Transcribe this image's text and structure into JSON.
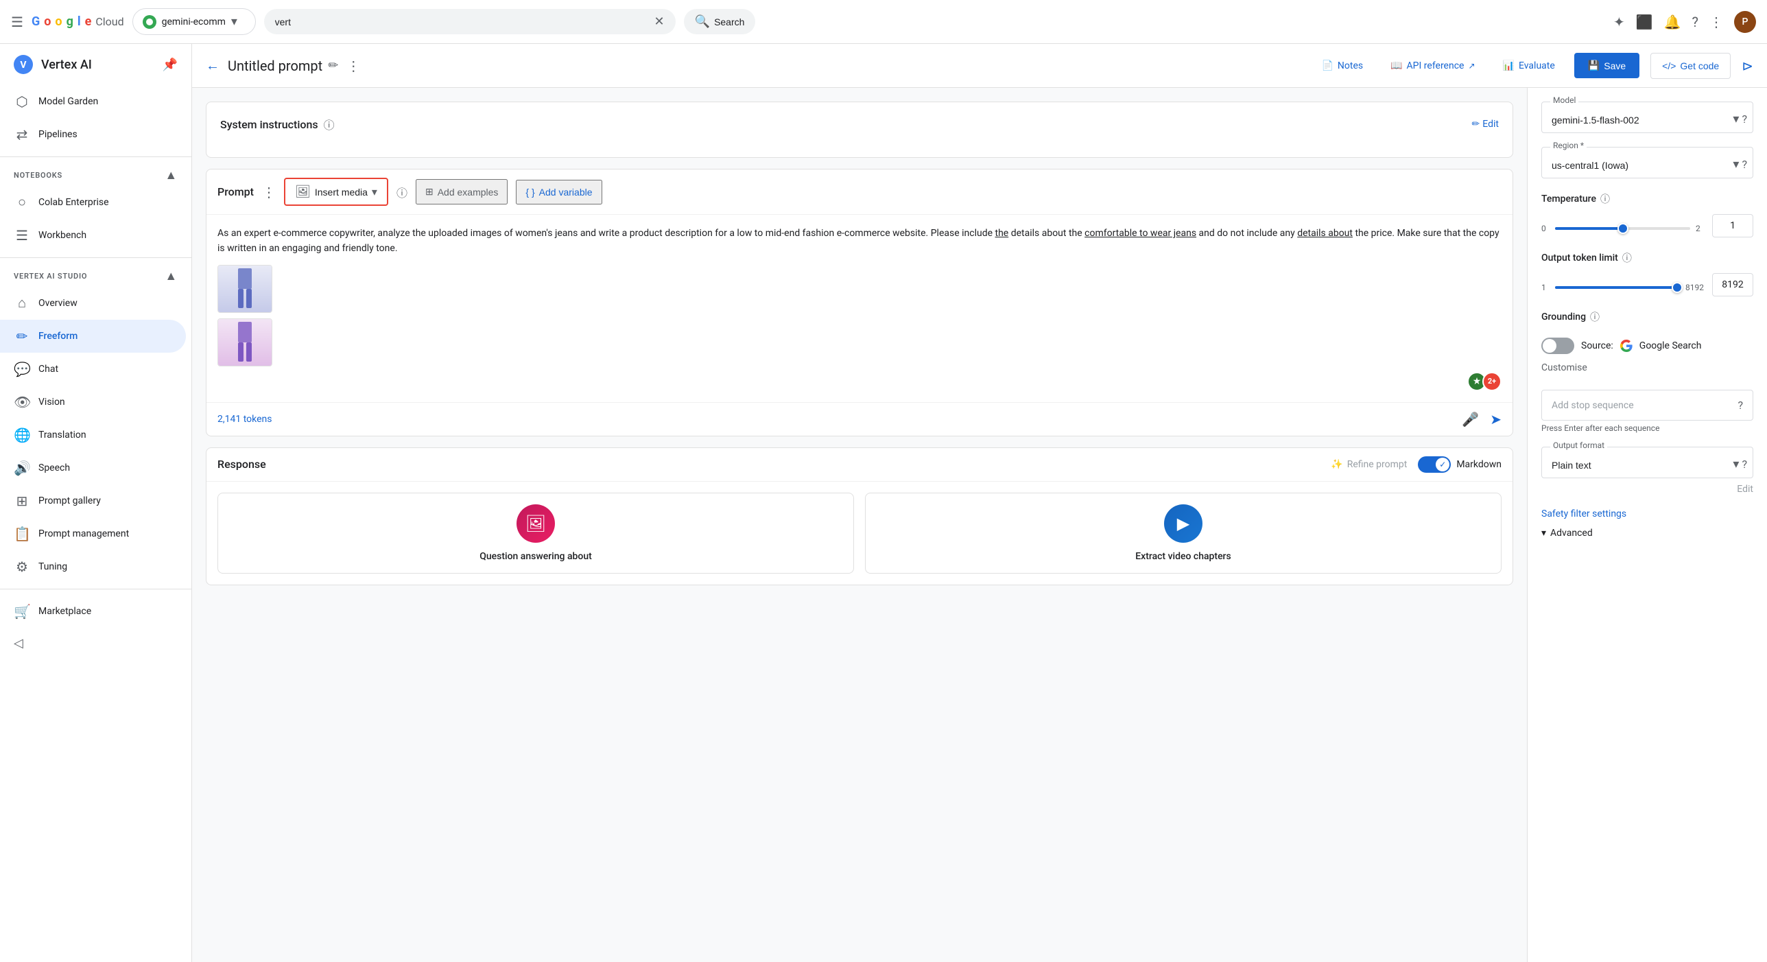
{
  "topbar": {
    "hamburger_label": "☰",
    "logo_g": "G",
    "logo_o1": "o",
    "logo_o2": "o",
    "logo_g2": "g",
    "logo_l": "l",
    "logo_e": "e",
    "logo_cloud": " Cloud",
    "project_name": "gemini-ecomm",
    "search_value": "vert",
    "search_placeholder": "Search",
    "search_button_label": "Search"
  },
  "sidebar": {
    "title": "Vertex AI",
    "items_top": [
      {
        "label": "Model Garden",
        "icon": "⬡"
      },
      {
        "label": "Pipelines",
        "icon": "⇄"
      }
    ],
    "notebooks_section": "NOTEBOOKS",
    "notebooks_items": [
      {
        "label": "Colab Enterprise",
        "icon": "○"
      },
      {
        "label": "Workbench",
        "icon": "☰"
      }
    ],
    "vertex_section": "VERTEX AI STUDIO",
    "vertex_items": [
      {
        "label": "Overview",
        "icon": "⌂"
      },
      {
        "label": "Freeform",
        "icon": "✏",
        "active": true
      },
      {
        "label": "Chat",
        "icon": "💬"
      },
      {
        "label": "Vision",
        "icon": "👁"
      },
      {
        "label": "Translation",
        "icon": "🌐"
      },
      {
        "label": "Speech",
        "icon": "🔊"
      },
      {
        "label": "Prompt gallery",
        "icon": "⊞"
      },
      {
        "label": "Prompt management",
        "icon": "📋"
      },
      {
        "label": "Tuning",
        "icon": "⚙"
      }
    ],
    "bottom_items": [
      {
        "label": "Marketplace",
        "icon": "🛒"
      }
    ],
    "collapse_icon": "◁"
  },
  "prompt_header": {
    "title": "Untitled prompt",
    "back_icon": "←",
    "edit_icon": "✏",
    "more_icon": "⋮",
    "notes_label": "Notes",
    "api_ref_label": "API reference",
    "evaluate_label": "Evaluate",
    "save_label": "Save",
    "get_code_label": "Get code",
    "expand_label": "⊳"
  },
  "system_instructions": {
    "title": "System instructions",
    "help_icon": "?",
    "edit_label": "Edit"
  },
  "prompt_section": {
    "label": "Prompt",
    "insert_media_label": "Insert media",
    "add_examples_label": "Add examples",
    "add_variable_label": "Add variable",
    "prompt_text": "As an expert e-commerce copywriter, analyze the uploaded images of women's jeans and write a product description for a low to mid-end fashion e-commerce website. Please include the details about the comfortable to wear jeans and do not include any details about the price. Make sure that the copy is written in an engaging and friendly tone.",
    "token_count": "2,141 tokens",
    "images": [
      {
        "alt": "Women jeans front view",
        "figure": "👗"
      },
      {
        "alt": "Women jeans side view",
        "figure": "👗"
      }
    ]
  },
  "response_section": {
    "label": "Response",
    "refine_label": "Refine prompt",
    "markdown_label": "Markdown",
    "cards": [
      {
        "title": "Question answering about",
        "icon": "🖼",
        "color": "pink"
      },
      {
        "title": "Extract video chapters",
        "icon": "▶",
        "color": "blue"
      }
    ]
  },
  "right_panel": {
    "model_label": "Model",
    "model_value": "gemini-1.5-flash-002",
    "region_label": "Region *",
    "region_value": "us-central1 (Iowa)",
    "temperature_label": "Temperature",
    "temperature_min": "0",
    "temperature_max": "2",
    "temperature_value": "1",
    "temperature_percent": 50,
    "token_limit_label": "Output token limit",
    "token_min": "1",
    "token_max": "8192",
    "token_value": "8192",
    "token_percent": 98,
    "grounding_label": "Grounding",
    "grounding_source": "Google Search",
    "customise_label": "Customise",
    "stop_seq_label": "Add stop sequence",
    "stop_seq_placeholder": "Add stop sequence",
    "stop_seq_hint": "Press Enter after each sequence",
    "output_format_label": "Output format",
    "output_format_value": "Plain text",
    "output_format_edit": "Edit",
    "safety_link": "Safety filter settings",
    "advanced_label": "Advanced"
  }
}
